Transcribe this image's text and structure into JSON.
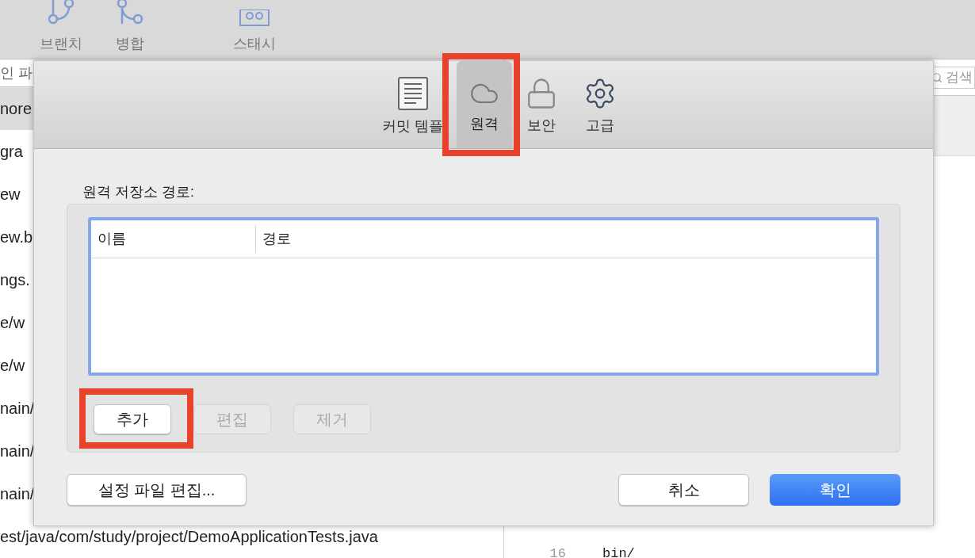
{
  "toolbar": [
    {
      "label": "브랜치",
      "kind": "branch"
    },
    {
      "label": "병합",
      "kind": "merge"
    },
    {
      "label": "스태시",
      "kind": "stash"
    }
  ],
  "file_list": {
    "header": "인 파",
    "items": [
      {
        "text": "nore",
        "selected": true
      },
      {
        "text": "gra",
        "selected": false
      },
      {
        "text": "ew",
        "selected": false
      },
      {
        "text": "ew.b",
        "selected": false
      },
      {
        "text": "ngs.",
        "selected": false
      },
      {
        "text": "e/w",
        "selected": false
      },
      {
        "text": "e/w",
        "selected": false
      },
      {
        "text": "nain/",
        "selected": false
      },
      {
        "text": "nain/",
        "selected": false
      },
      {
        "text": "nain/",
        "selected": false
      },
      {
        "text": "est/java/com/study/project/DemoApplicationTests.java",
        "selected": false
      }
    ]
  },
  "search": {
    "placeholder": "검색"
  },
  "editor": {
    "line_number": "16",
    "line": "bin/"
  },
  "dialog": {
    "tabs": [
      {
        "label": "커밋 템플",
        "kind": "document",
        "selected": false,
        "highlighted": false
      },
      {
        "label": "원격",
        "kind": "cloud",
        "selected": true,
        "highlighted": true
      },
      {
        "label": "보안",
        "kind": "lock",
        "selected": false,
        "highlighted": false
      },
      {
        "label": "고급",
        "kind": "gear",
        "selected": false,
        "highlighted": false
      }
    ],
    "section_label": "원격 저장소 경로:",
    "table": {
      "columns": [
        "이름",
        "경로"
      ]
    },
    "list_buttons": [
      {
        "label": "추가",
        "disabled": false,
        "highlighted": true
      },
      {
        "label": "편집",
        "disabled": true,
        "highlighted": false
      },
      {
        "label": "제거",
        "disabled": true,
        "highlighted": false
      }
    ],
    "footer_buttons": [
      {
        "label": "설정 파일 편집...",
        "kind": "default"
      },
      {
        "label": "취소",
        "kind": "default"
      },
      {
        "label": "확인",
        "kind": "primary"
      }
    ]
  }
}
